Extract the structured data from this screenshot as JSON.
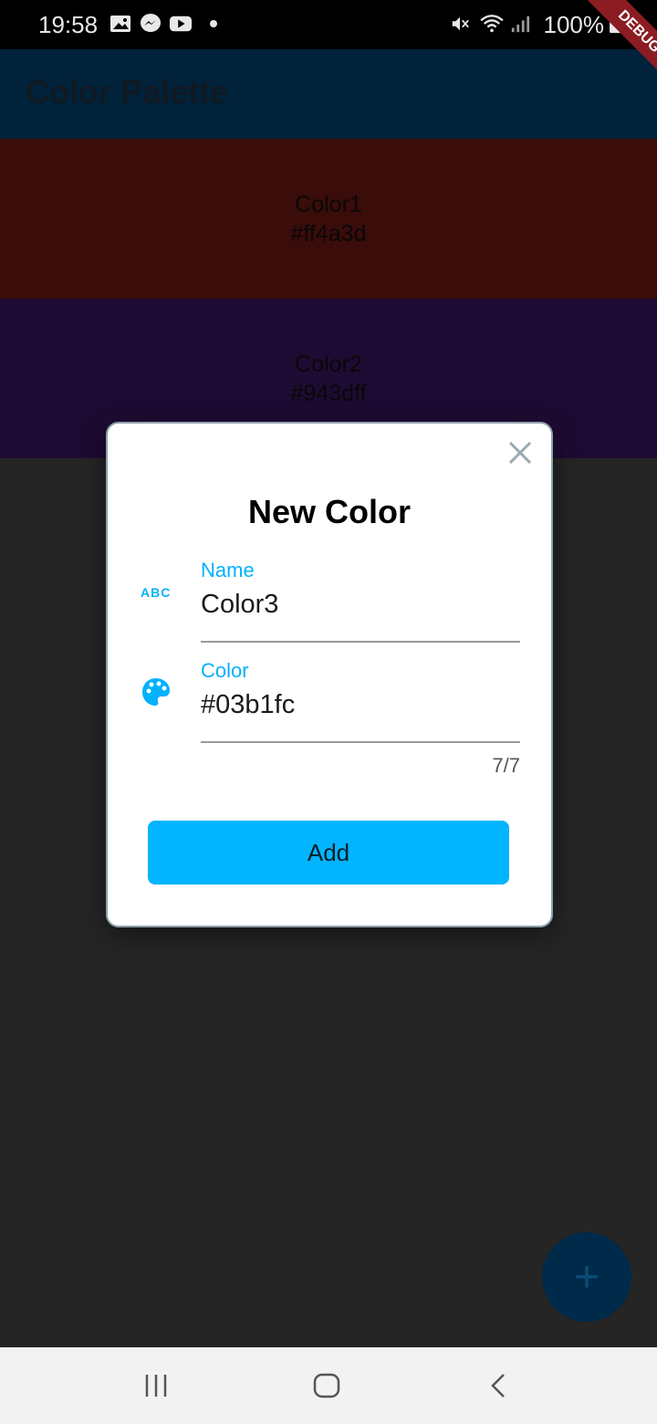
{
  "status_bar": {
    "time": "19:58",
    "battery": "100%",
    "icons": [
      "image-icon",
      "messenger-icon",
      "youtube-icon",
      "dot-icon",
      "mute-icon",
      "wifi-icon",
      "signal-icon",
      "battery-icon"
    ]
  },
  "app_bar": {
    "title": "Color Palette"
  },
  "tiles": [
    {
      "name": "Color1",
      "hex": "#ff4a3d"
    },
    {
      "name": "Color2",
      "hex": "#943dff"
    }
  ],
  "dialog": {
    "title": "New Color",
    "name_icon": "ABC",
    "name_label": "Name",
    "name_value": "Color3",
    "color_label": "Color",
    "color_value": "#03b1fc",
    "counter": "7/7",
    "add_label": "Add"
  },
  "fab": {
    "symbol": "+"
  },
  "debug_banner": "DEBUG",
  "colors": {
    "accent": "#03b1fc",
    "button": "#03b4fe",
    "app_bar": "#00223a"
  }
}
